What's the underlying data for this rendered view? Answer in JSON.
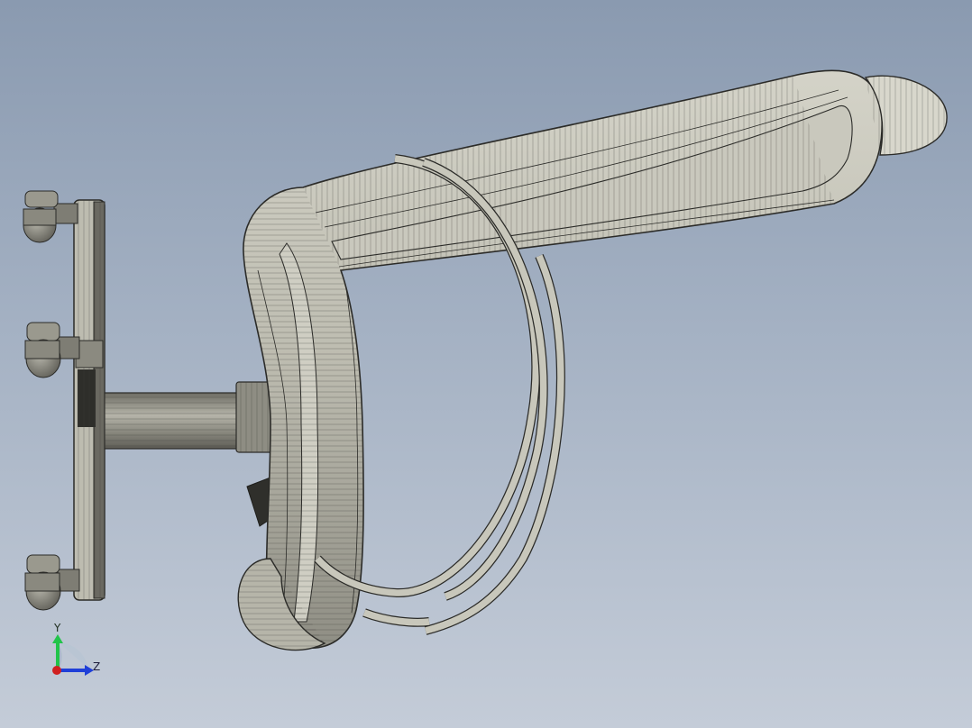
{
  "viewport": {
    "background_top": "#8a9ab0",
    "background_bottom": "#c4ccd8"
  },
  "model": {
    "shaded_color": "#c3c2b6",
    "edge_color": "#2b2b28",
    "components": [
      "mounting-plate",
      "knob-top",
      "knob-middle",
      "knob-bottom",
      "connecting-shaft",
      "shaft-collar",
      "curved-arm-body",
      "arm-end-cap",
      "curved-strap-bands"
    ]
  },
  "triad": {
    "y_label": "Y",
    "z_label": "Z",
    "y_color": "#22c44a",
    "z_color": "#1f3fd8",
    "x_color": "#d02020"
  }
}
